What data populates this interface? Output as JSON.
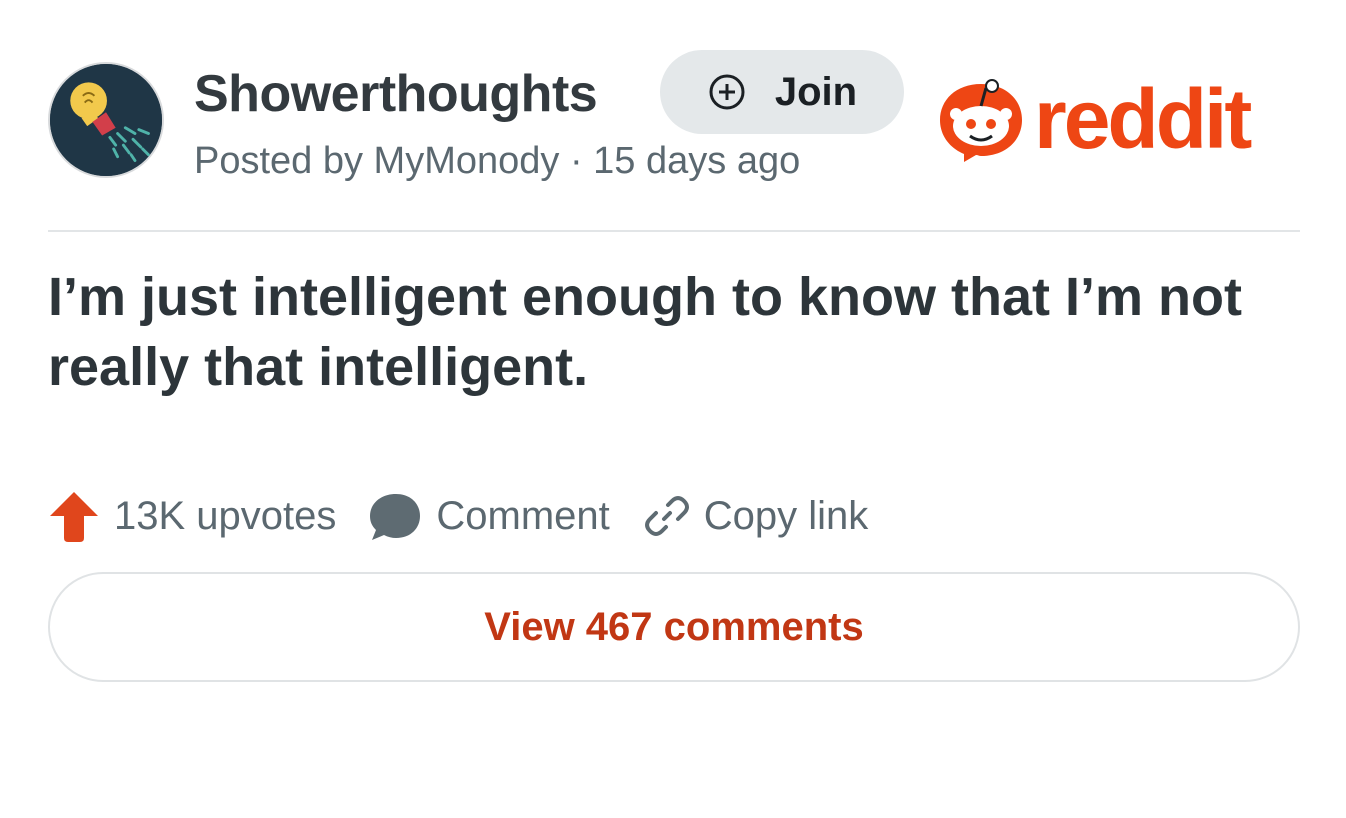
{
  "header": {
    "subreddit": "Showerthoughts",
    "join_label": "Join",
    "posted_by": "Posted by MyMonody · 15 days ago",
    "brand": "reddit",
    "brand_color": "#ee4614"
  },
  "post": {
    "title": "I’m just intelligent enough to know that I’m not really that intelligent."
  },
  "actions": {
    "upvotes": "13K upvotes",
    "comment": "Comment",
    "copy_link": "Copy link"
  },
  "footer": {
    "view_comments": "View 467 comments",
    "accent_color": "#c13714"
  },
  "icons": [
    "subreddit-avatar-lightbulb-icon",
    "plus-circle-icon",
    "snoo-icon",
    "upvote-arrow-icon",
    "comment-bubble-icon",
    "link-icon"
  ]
}
